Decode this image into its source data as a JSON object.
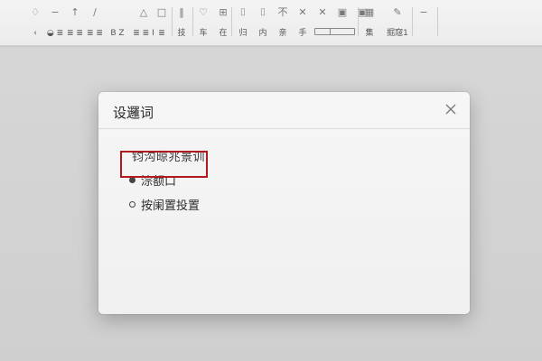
{
  "toolbar": {
    "groups": [
      {
        "buttons": [
          {
            "icon": "drop-icon",
            "glyph": "♢",
            "label": "‹"
          },
          {
            "icon": "strikeline-icon",
            "glyph": "−",
            "label": "‹"
          },
          {
            "icon": "arrow-up-icon",
            "glyph": "↑",
            "label": "‹"
          },
          {
            "icon": "brush-icon",
            "glyph": "∕",
            "label": "‹"
          },
          {
            "icon": "warning-icon",
            "glyph": "△",
            "label": "‹"
          }
        ],
        "secondary": [
          "‹ ‹",
          "◒ ≣",
          "≣ ≣",
          "≣ ≣",
          "B Z",
          "≣ ≣ I"
        ]
      }
    ],
    "group2": [
      {
        "icon": "box-icon",
        "glyph": "□",
        "label": "≣"
      },
      {
        "icon": "tab-icon",
        "glyph": "‖",
        "label": "技"
      }
    ],
    "group3": [
      {
        "icon": "heart-icon",
        "glyph": "♡",
        "label": "车"
      },
      {
        "icon": "grid-icon",
        "glyph": "⊞",
        "label": "在"
      }
    ],
    "group4": [
      {
        "icon": "table-icon",
        "glyph": "⌷",
        "label": "归"
      },
      {
        "icon": "image-icon",
        "glyph": "⌷",
        "label": "内"
      },
      {
        "icon": "not-icon",
        "glyph": "不",
        "label": "亲"
      },
      {
        "icon": "cut-icon",
        "glyph": "✕",
        "label": "手"
      },
      {
        "icon": "scissors-icon",
        "glyph": "✕",
        "label": "−"
      },
      {
        "icon": "box2-icon",
        "glyph": "▣",
        "label": "−"
      },
      {
        "icon": "box3-icon",
        "glyph": "▣",
        "label": "−"
      }
    ],
    "group5": [
      {
        "icon": "frame-icon",
        "glyph": "▦",
        "label": "集"
      },
      {
        "icon": "edit-icon",
        "glyph": "✎",
        "label": "掘窛1"
      }
    ],
    "group6": [
      {
        "icon": "minus-icon",
        "glyph": "−",
        "label": ""
      }
    ]
  },
  "dialog": {
    "title": "设邏词",
    "close_glyph": "✕",
    "section_label": "钧沟晾兆景训",
    "options": [
      {
        "label": "淙额口",
        "checked": true
      },
      {
        "label": "按阑置投置",
        "checked": false
      }
    ]
  },
  "colors": {
    "highlight": "#b0191e"
  }
}
